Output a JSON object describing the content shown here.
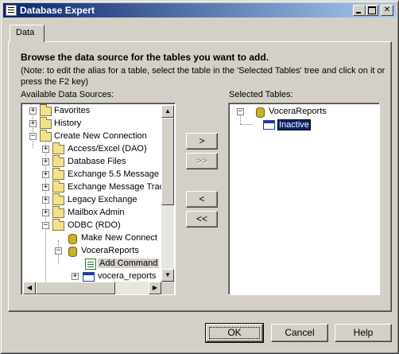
{
  "window": {
    "title": "Database Expert"
  },
  "tabs": [
    {
      "label": "Data"
    }
  ],
  "instructions": {
    "heading": "Browse the data source for the tables you want to add.",
    "note": "(Note: to edit the alias for a table, select the table in the 'Selected Tables' tree and click on it or press the F2 key)"
  },
  "available": {
    "label": "Available Data Sources:",
    "items": [
      {
        "label": "Favorites"
      },
      {
        "label": "History"
      },
      {
        "label": "Create New Connection"
      },
      {
        "label": "Access/Excel (DAO)"
      },
      {
        "label": "Database Files"
      },
      {
        "label": "Exchange 5.5 Message"
      },
      {
        "label": "Exchange Message Trac"
      },
      {
        "label": "Legacy Exchange"
      },
      {
        "label": "Mailbox Admin"
      },
      {
        "label": "ODBC (RDO)"
      },
      {
        "label": "Make New Connect"
      },
      {
        "label": "VoceraReports"
      },
      {
        "label": "Add Command"
      },
      {
        "label": "vocera_reports"
      }
    ]
  },
  "selected": {
    "label": "Selected Tables:",
    "items": [
      {
        "label": "VoceraReports"
      },
      {
        "label": "Inactive"
      }
    ]
  },
  "move_buttons": {
    "add_one": ">",
    "add_all": ">>",
    "remove_one": "<",
    "remove_all": "<<"
  },
  "footer": {
    "ok": "OK",
    "cancel": "Cancel",
    "help": "Help"
  }
}
